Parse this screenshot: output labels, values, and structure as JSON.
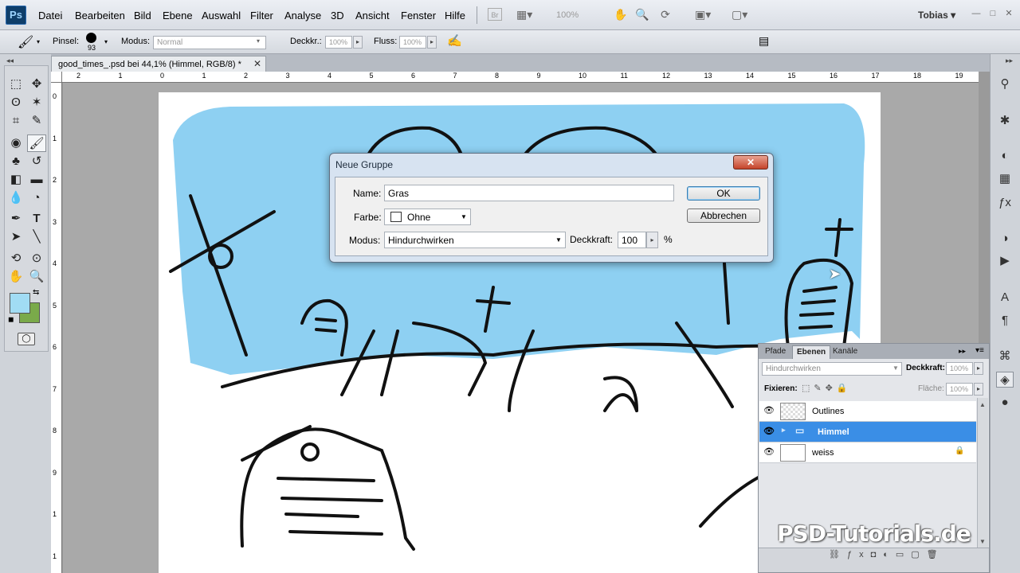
{
  "app": {
    "logo": "Ps",
    "user": "Tobias",
    "zoom": "100%"
  },
  "menu": [
    "Datei",
    "Bearbeiten",
    "Bild",
    "Ebene",
    "Auswahl",
    "Filter",
    "Analyse",
    "3D",
    "Ansicht",
    "Fenster",
    "Hilfe"
  ],
  "options": {
    "brush_label": "Pinsel:",
    "brush_size": "93",
    "mode_label": "Modus:",
    "mode_value": "Normal",
    "opacity_label": "Deckkr.:",
    "opacity_value": "100%",
    "flow_label": "Fluss:",
    "flow_value": "100%"
  },
  "document": {
    "tab_title": "good_times_.psd bei 44,1% (Himmel, RGB/8) *"
  },
  "ruler": {
    "h_ticks": [
      "2",
      "1",
      "0",
      "1",
      "2",
      "3",
      "4",
      "5",
      "6",
      "7",
      "8",
      "9",
      "10",
      "11",
      "12",
      "13",
      "14",
      "15",
      "16",
      "17",
      "18",
      "19"
    ],
    "v_ticks": [
      "0",
      "1",
      "2",
      "3",
      "4",
      "5",
      "6",
      "7",
      "8",
      "9",
      "1",
      "1"
    ]
  },
  "dialog": {
    "title": "Neue Gruppe",
    "name_label": "Name:",
    "name_value": "Gras",
    "color_label": "Farbe:",
    "color_value": "Ohne",
    "mode_label": "Modus:",
    "mode_value": "Hindurchwirken",
    "opacity_label": "Deckkraft:",
    "opacity_value": "100",
    "opacity_unit": "%",
    "ok_label": "OK",
    "cancel_label": "Abbrechen"
  },
  "layers_panel": {
    "tabs": [
      "Pfade",
      "Ebenen",
      "Kanäle"
    ],
    "blend_mode": "Hindurchwirken",
    "opacity_label": "Deckkraft:",
    "opacity_value": "100%",
    "lock_label": "Fixieren:",
    "fill_label": "Fläche:",
    "fill_value": "100%",
    "layers": [
      {
        "name": "Outlines"
      },
      {
        "name": "Himmel"
      },
      {
        "name": "weiss"
      }
    ]
  },
  "colors": {
    "foreground": "#a1dcf4",
    "background": "#7aaa4a",
    "sky": "#8ed0f2",
    "selection": "#3a8ee6"
  },
  "watermark": "PSD-Tutorials.de"
}
